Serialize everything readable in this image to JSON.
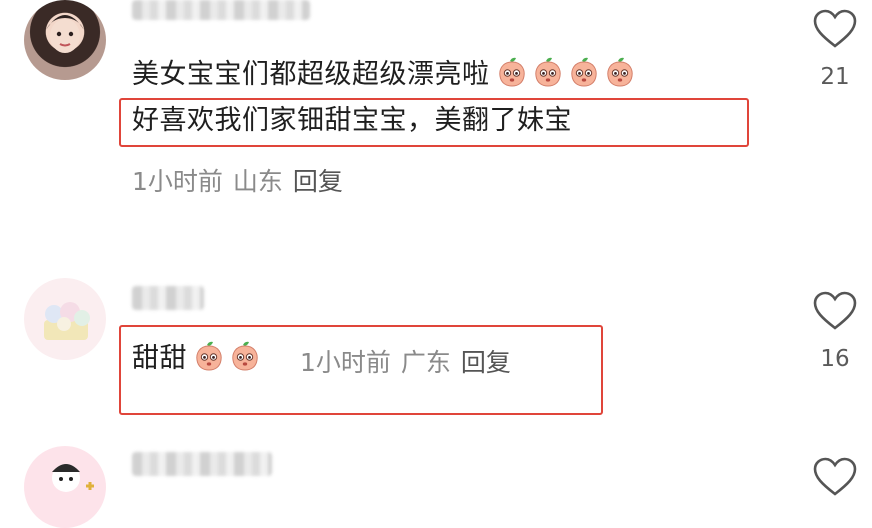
{
  "comments": [
    {
      "lines": [
        "美女宝宝们都超级超级漂亮啦",
        "好喜欢我们家钿甜宝宝，美翻了妹宝"
      ],
      "emoji_count": 4,
      "time": "1小时前",
      "location": "山东",
      "reply_label": "回复",
      "likes": "21"
    },
    {
      "lines": [
        "甜甜"
      ],
      "emoji_count": 2,
      "time": "1小时前",
      "location": "广东",
      "reply_label": "回复",
      "likes": "16"
    }
  ],
  "icons": {
    "like": "heart-outline-icon",
    "emoji": "peach-face-emoji-icon"
  },
  "colors": {
    "highlight_box": "#e0453a",
    "meta_text": "#8a8a8a",
    "body_text": "#1f1f1f"
  }
}
